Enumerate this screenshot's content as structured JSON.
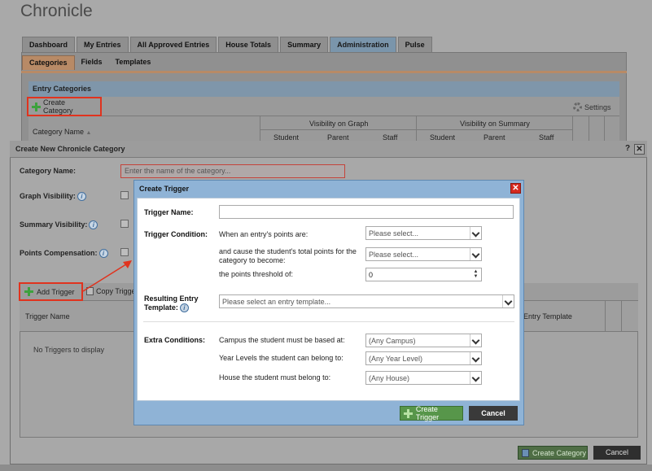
{
  "app": {
    "title": "Chronicle"
  },
  "tabs": [
    "Dashboard",
    "My Entries",
    "All Approved Entries",
    "House Totals",
    "Summary",
    "Administration",
    "Pulse"
  ],
  "active_tab": "Administration",
  "subtabs": [
    "Categories",
    "Fields",
    "Templates"
  ],
  "active_subtab": "Categories",
  "entry_categories": {
    "header": "Entry Categories",
    "create_label": "Create Category",
    "settings_label": "Settings",
    "col_category_name": "Category Name",
    "col_visibility_graph": "Visibility on Graph",
    "col_visibility_summary": "Visibility on Summary",
    "col_student": "Student",
    "col_parent": "Parent",
    "col_staff": "Staff"
  },
  "dialog": {
    "title": "Create New Chronicle Category",
    "help": "?",
    "close": "✕",
    "category_name_label": "Category Name:",
    "category_name_placeholder": "Enter the name of the category...",
    "graph_visibility_label": "Graph Visibility:",
    "summary_visibility_label": "Summary Visibility:",
    "points_compensation_label": "Points Compensation:",
    "add_trigger_label": "Add Trigger",
    "copy_trigger_label": "Copy Trigger",
    "col_trigger_name": "Trigger Name",
    "col_entry_template": "Entry Template",
    "no_triggers": "No Triggers to display",
    "create_category_label": "Create Category",
    "cancel_label": "Cancel"
  },
  "modal": {
    "title": "Create Trigger",
    "close": "✕",
    "trigger_name_label": "Trigger Name:",
    "trigger_condition_label": "Trigger Condition:",
    "cond1_text": "When an entry's points are:",
    "cond1_value": "Please select...",
    "cond2_text": "and cause the student's total points for the category to become:",
    "cond2_value": "Please select...",
    "cond3_text": "the points threshold of:",
    "cond3_value": "0",
    "resulting_label": "Resulting Entry Template:",
    "resulting_value": "Please select an entry template...",
    "extra_label": "Extra Conditions:",
    "campus_text": "Campus the student must be based at:",
    "campus_value": "(Any Campus)",
    "year_text": "Year Levels the student can belong to:",
    "year_value": "(Any Year Level)",
    "house_text": "House the student must belong to:",
    "house_value": "(Any House)",
    "create_trigger_label": "Create Trigger",
    "cancel_label": "Cancel"
  },
  "colors": {
    "highlight": "#e0331e",
    "modal_frame": "#8fb3d6",
    "create_green": "#57964a"
  }
}
